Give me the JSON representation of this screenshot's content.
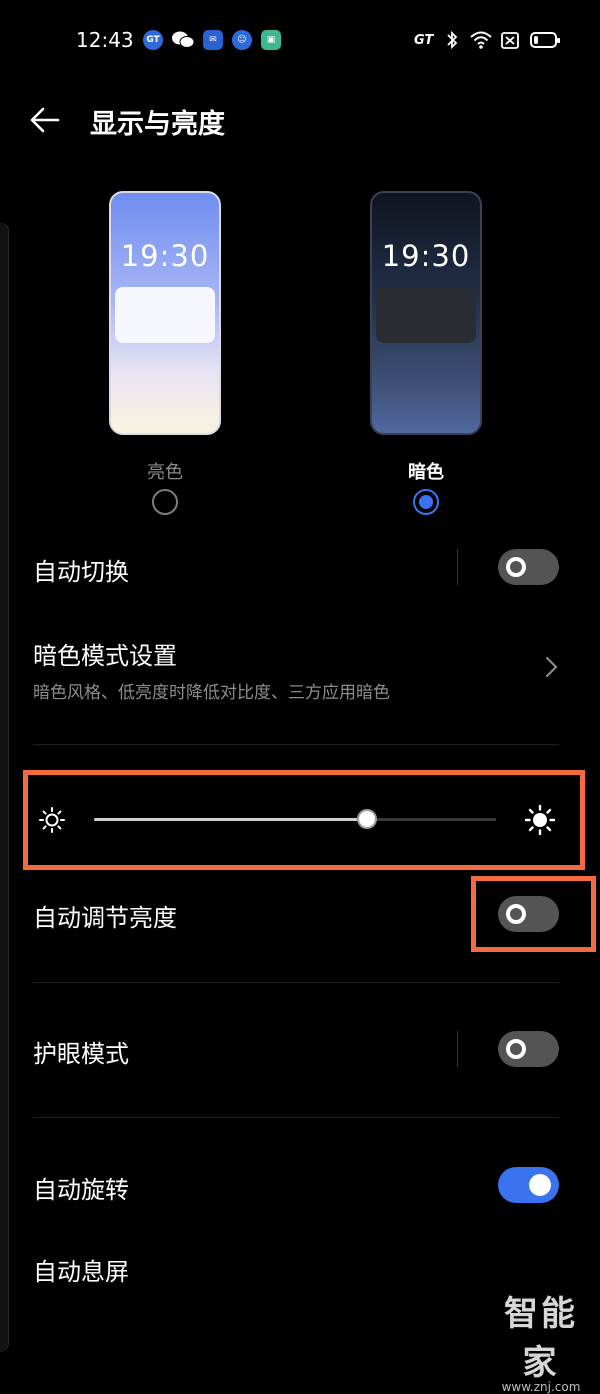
{
  "status_bar": {
    "time": "12:43",
    "app_icons": [
      "gt-app-icon",
      "wechat-icon",
      "message-icon",
      "chat-icon",
      "store-icon"
    ],
    "gt_label": "GT",
    "right_icons": [
      "bluetooth-icon",
      "wifi-icon",
      "sim-off-icon",
      "battery-icon"
    ],
    "battery_level": 0.2
  },
  "header": {
    "title": "显示与亮度",
    "back_icon": "arrow-left-icon"
  },
  "theme": {
    "light": {
      "label": "亮色",
      "preview_time": "19:30",
      "selected": false
    },
    "dark": {
      "label": "暗色",
      "preview_time": "19:30",
      "selected": true
    }
  },
  "settings": {
    "auto_switch": {
      "label": "自动切换",
      "on": false
    },
    "dark_mode_settings": {
      "label": "暗色模式设置",
      "subtitle": "暗色风格、低亮度时降低对比度、三方应用暗色"
    },
    "brightness": {
      "level_percent": 68
    },
    "auto_brightness": {
      "label": "自动调节亮度",
      "on": false
    },
    "eye_comfort": {
      "label": "护眼模式",
      "on": false
    },
    "auto_rotate": {
      "label": "自动旋转",
      "on": true
    },
    "auto_screen_off": {
      "label": "自动息屏"
    }
  },
  "colors": {
    "accent": "#3a73f0",
    "highlight": "#f46b42",
    "background": "#000000"
  },
  "watermark": {
    "logo": "智能家",
    "url": "www.znj.com"
  }
}
